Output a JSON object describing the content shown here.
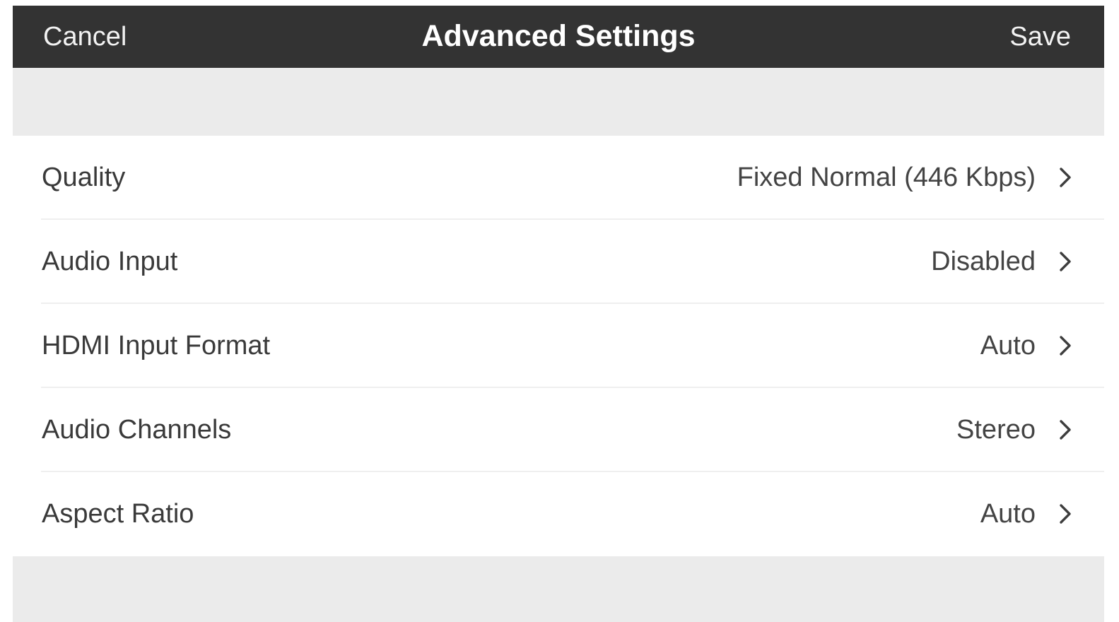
{
  "header": {
    "cancel_label": "Cancel",
    "title": "Advanced Settings",
    "save_label": "Save"
  },
  "settings": [
    {
      "label": "Quality",
      "value": "Fixed Normal (446 Kbps)",
      "icon": "chevron-right-icon"
    },
    {
      "label": "Audio Input",
      "value": "Disabled",
      "icon": "chevron-right-icon"
    },
    {
      "label": "HDMI Input Format",
      "value": "Auto",
      "icon": "chevron-right-icon"
    },
    {
      "label": "Audio Channels",
      "value": "Stereo",
      "icon": "chevron-right-icon"
    },
    {
      "label": "Aspect Ratio",
      "value": "Auto",
      "icon": "chevron-right-icon"
    }
  ],
  "colors": {
    "navbar_bg": "#333333",
    "group_bg": "#ebebeb",
    "row_bg": "#ffffff",
    "text": "#3a3a3a"
  }
}
